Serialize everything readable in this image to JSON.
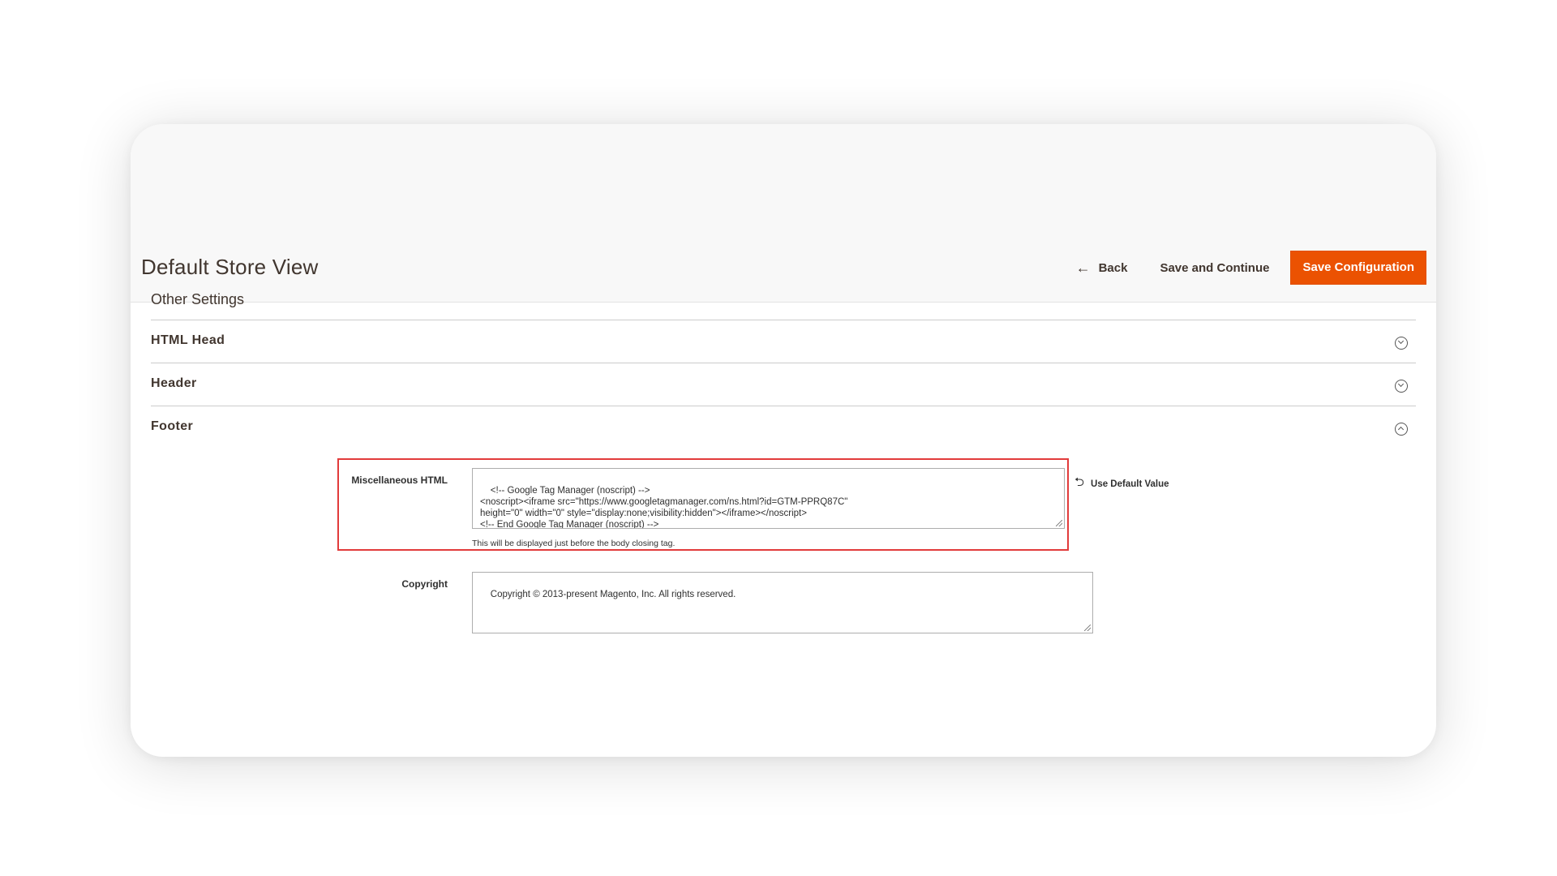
{
  "header": {
    "title": "Default Store View",
    "back_label": "Back",
    "save_continue_label": "Save and Continue",
    "save_config_label": "Save Configuration"
  },
  "section": {
    "title": "Other Settings",
    "groups": [
      {
        "label": "HTML Head",
        "state": "collapsed",
        "icon": "chevron-down-icon"
      },
      {
        "label": "Header",
        "state": "collapsed",
        "icon": "chevron-down-icon"
      },
      {
        "label": "Footer",
        "state": "expanded",
        "icon": "chevron-up-icon"
      }
    ]
  },
  "footer_fields": {
    "misc_html": {
      "label": "Miscellaneous HTML",
      "value": "<!-- Google Tag Manager (noscript) -->\n<noscript><iframe src=\"https://www.googletagmanager.com/ns.html?id=GTM-PPRQ87C\"\nheight=\"0\" width=\"0\" style=\"display:none;visibility:hidden\"></iframe></noscript>\n<!-- End Google Tag Manager (noscript) -->",
      "note": "This will be displayed just before the body closing tag.",
      "use_default_label": "Use Default Value"
    },
    "copyright": {
      "label": "Copyright",
      "value": "Copyright © 2013-present Magento, Inc. All rights reserved."
    }
  },
  "colors": {
    "accent": "#eb5202",
    "highlight": "#e23b3b"
  }
}
